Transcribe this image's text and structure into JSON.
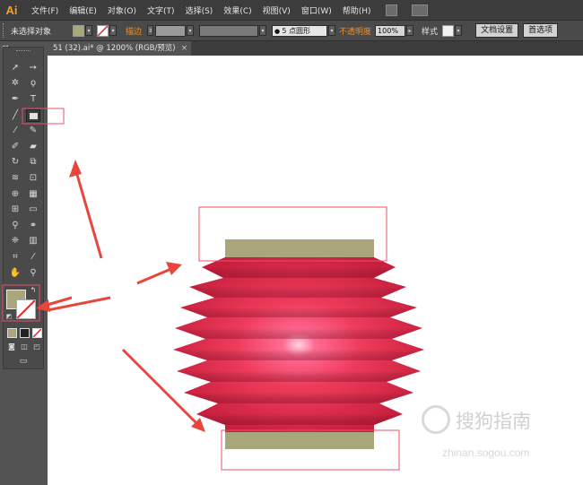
{
  "app": {
    "logo": "Ai"
  },
  "menu": [
    "文件(F)",
    "编辑(E)",
    "对象(O)",
    "文字(T)",
    "选择(S)",
    "效果(C)",
    "视图(V)",
    "窗口(W)",
    "帮助(H)"
  ],
  "control_bar": {
    "selection_label": "未选择对象",
    "fill_color": "#a8a67a",
    "stroke_label": "描边",
    "brush_value": "5 点圆形",
    "opacity_label": "不透明度",
    "opacity_value": "100%",
    "style_label": "样式",
    "doc_setup_button": "文档设置",
    "preferences_button": "首选项"
  },
  "document_tab": {
    "title": "51 (32).ai* @ 1200% (RGB/预览)",
    "close": "×"
  },
  "colors": {
    "accent_orange": "#f0902c",
    "lantern_red": "#e0344e",
    "lantern_glow": "#ff8fb0",
    "lantern_cap": "#a8a67a",
    "highlight_box": "#e8506a",
    "arrow": "#e8463c"
  },
  "watermark": {
    "text": "搜狗指南",
    "sub": "zhinan.sogou.com"
  }
}
